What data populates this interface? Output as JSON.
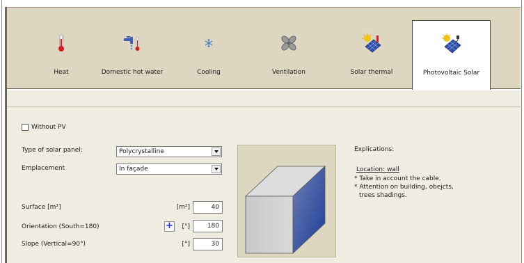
{
  "tabs": [
    {
      "id": "heat",
      "label": "Heat",
      "icon": "thermometer-icon",
      "active": false
    },
    {
      "id": "dhw",
      "label": "Domestic hot water",
      "icon": "faucet-thermometer-icon",
      "active": false
    },
    {
      "id": "cooling",
      "label": "Cooling",
      "icon": "snowflake-icon",
      "active": false
    },
    {
      "id": "ventilation",
      "label": "Ventilation",
      "icon": "fan-icon",
      "active": false
    },
    {
      "id": "solar_thermal",
      "label": "Solar thermal",
      "icon": "solar-thermal-icon",
      "active": false
    },
    {
      "id": "pv",
      "label": "Photovoltaic Solar",
      "icon": "pv-panel-icon",
      "active": true
    }
  ],
  "form": {
    "without_pv_label": "Without PV",
    "without_pv_checked": false,
    "panel_type_label": "Type of solar panel:",
    "panel_type_value": "Polycrystalline",
    "emplacement_label": "Emplacement",
    "emplacement_value": "In façade",
    "surface_label": "Surface [m²]",
    "surface_unit": "[m²]",
    "surface_value": "40",
    "orientation_label": "Orientation (South=180)",
    "orientation_unit": "[°]",
    "orientation_value": "180",
    "slope_label": "Slope (Vertical=90°)",
    "slope_unit": "[°]",
    "slope_value": "30",
    "plus_label": "+"
  },
  "explications": {
    "title": "Explications:",
    "location": "Location: wall",
    "line1": "* Take in account the cable.",
    "line2": "* Attention on building, obejcts,",
    "line3": "trees shadings."
  },
  "colors": {
    "tab_bg": "#ddd6c1",
    "panel_bg": "#efede1",
    "plus_blue": "#1a2dd8"
  }
}
